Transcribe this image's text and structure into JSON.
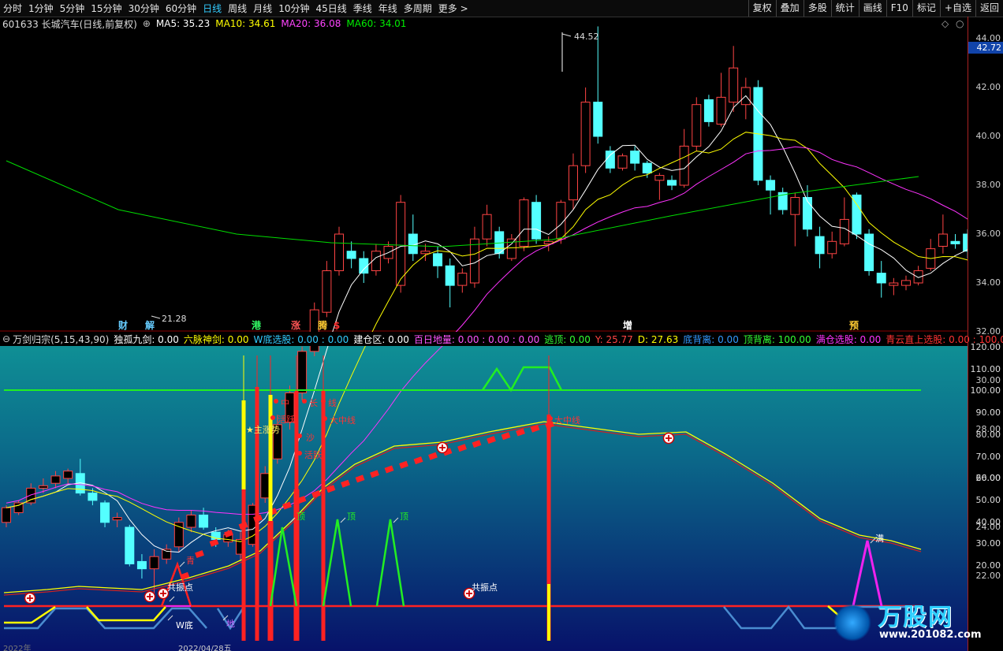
{
  "toolbar": {
    "periods": [
      "分时",
      "1分钟",
      "5分钟",
      "15分钟",
      "30分钟",
      "60分钟",
      "日线",
      "周线",
      "月线",
      "10分钟",
      "45日线",
      "季线",
      "年线",
      "多周期",
      "更多 >"
    ],
    "active_period": "日线",
    "buttons": [
      "复权",
      "叠加",
      "多股",
      "统计",
      "画线",
      "F10",
      "标记",
      "+自选",
      "返回"
    ]
  },
  "stock": {
    "title": "601633 长城汽车(日线,前复权)",
    "ma5": "MA5: 35.23",
    "ma10": "MA10: 34.61",
    "ma20": "MA20: 36.08",
    "ma60": "MA60: 34.01",
    "current_price": "42.72",
    "high_label": "44.52",
    "low_label": "21.28",
    "colors": {
      "ma5": "#ffffff",
      "ma10": "#ffff00",
      "ma20": "#ff33ff",
      "ma60": "#00dd00",
      "up": "#ff4444",
      "down": "#54ffff"
    }
  },
  "price_axis": [
    "44.00",
    "42.00",
    "40.00",
    "38.00",
    "36.00",
    "34.00",
    "32.00",
    "30.00",
    "28.00",
    "26.00",
    "24.00",
    "22.00"
  ],
  "event_marks": [
    {
      "text": "财",
      "color": "#66ccff"
    },
    {
      "text": "解",
      "color": "#66ccff"
    },
    {
      "text": "港",
      "color": "#33ff66"
    },
    {
      "text": "涨",
      "color": "#ff5555"
    },
    {
      "text": "腾",
      "color": "#ffcc33"
    },
    {
      "text": "$",
      "color": "#ff3333"
    },
    {
      "text": "增",
      "color": "#ffffff"
    },
    {
      "text": "预",
      "color": "#ffcc33"
    }
  ],
  "indicator": {
    "name": "万剑归宗(5,15,43,90)",
    "items": [
      {
        "label": "独孤九剑: 0.00",
        "color": "#ffffff"
      },
      {
        "label": "六脉神剑: 0.00",
        "color": "#ffff00"
      },
      {
        "label": "W底选股: 0.00 : 0.00",
        "color": "#33ccff"
      },
      {
        "label": "建仓区: 0.00",
        "color": "#ffffff"
      },
      {
        "label": "百日地量: 0.00 : 0.00 : 0.00",
        "color": "#ff55ff"
      },
      {
        "label": "逃顶: 0.00",
        "color": "#33ff33"
      },
      {
        "label": "Y: 25.77",
        "color": "#ff4444"
      },
      {
        "label": "D: 27.63",
        "color": "#ffff00"
      },
      {
        "label": "底背离: 0.00",
        "color": "#3399ff"
      },
      {
        "label": "顶背离: 100.00",
        "color": "#33ff33"
      },
      {
        "label": "满仓选股: 0.00",
        "color": "#ff33ff"
      },
      {
        "label": "青云直上选股: 0.00 : 100.00",
        "color": "#ff3333"
      }
    ]
  },
  "ind_axis": [
    "120.00",
    "110.00",
    "100.00",
    "90.00",
    "80.00",
    "70.00",
    "60.00",
    "50.00",
    "40.00",
    "30.00",
    "20.00"
  ],
  "annotations": {
    "qing": "青",
    "gongzhen1": "共振点",
    "w_di": "W底",
    "di": "地",
    "ding1": "顶",
    "ding2": "顶",
    "ding3": "顶",
    "gongzhen2": "共振点",
    "man": "满",
    "zhuzhang": "★主涨势",
    "zhong": "中",
    "chang_a": "长",
    "xian": "线",
    "huo_a": "活跃",
    "shao_a": "沙",
    "huo_b": "活跃",
    "ji": "积",
    "kuan": "大中线",
    "zhongxian": "大中线"
  },
  "watermark": {
    "brand": "万股网",
    "url": "www.201082.com"
  },
  "bottom_axis": [
    "2022年",
    "2022/04/28五"
  ]
}
